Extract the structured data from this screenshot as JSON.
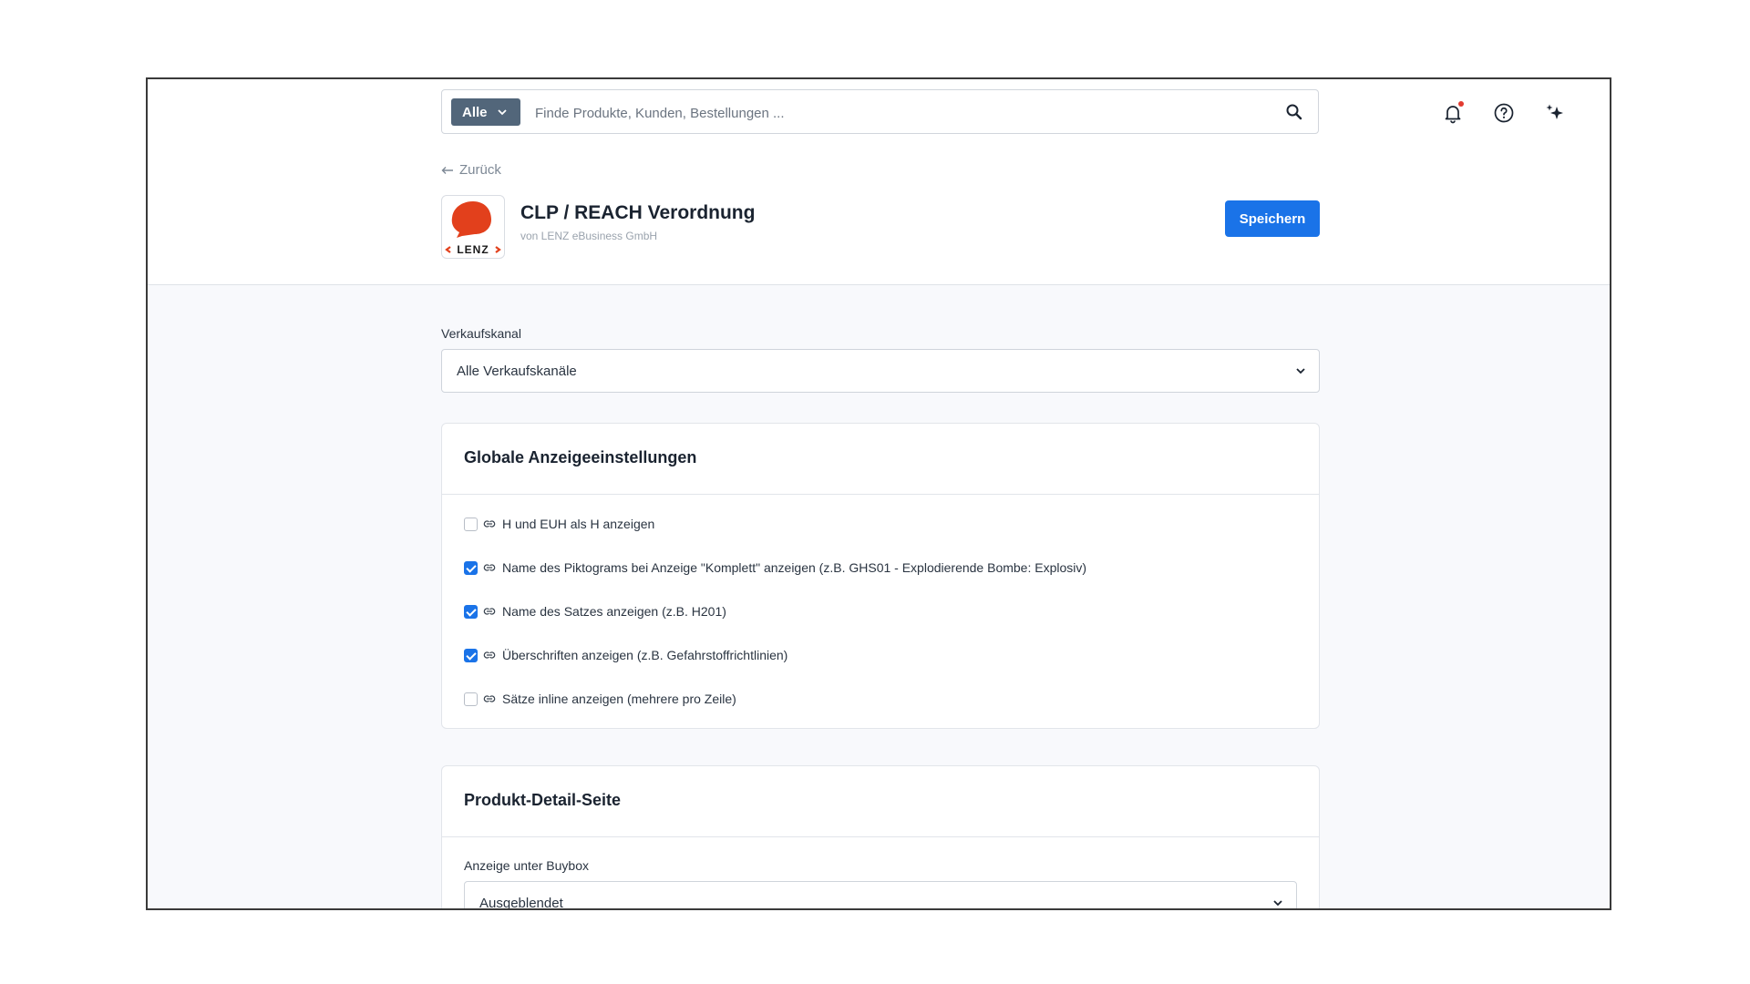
{
  "search": {
    "scope_label": "Alle",
    "placeholder": "Finde Produkte, Kunden, Bestellungen ..."
  },
  "header": {
    "back_label": "Zurück",
    "logo_text": "LENZ",
    "title": "CLP / REACH Verordnung",
    "vendor": "von LENZ eBusiness GmbH",
    "save_label": "Speichern"
  },
  "sales_channel": {
    "label": "Verkaufskanal",
    "value": "Alle Verkaufskanäle"
  },
  "global_settings": {
    "title": "Globale Anzeigeeinstellungen",
    "options": [
      {
        "label": "H und EUH als H anzeigen",
        "checked": false
      },
      {
        "label": "Name des Piktograms bei Anzeige \"Komplett\" anzeigen (z.B. GHS01 - Explodierende Bombe: Explosiv)",
        "checked": true
      },
      {
        "label": "Name des Satzes anzeigen (z.B. H201)",
        "checked": true
      },
      {
        "label": "Überschriften anzeigen (z.B. Gefahrstoffrichtlinien)",
        "checked": true
      },
      {
        "label": "Sätze inline anzeigen (mehrere pro Zeile)",
        "checked": false
      }
    ]
  },
  "product_detail": {
    "title": "Produkt-Detail-Seite",
    "buybox_label": "Anzeige unter Buybox",
    "buybox_value": "Ausgeblendet"
  },
  "colors": {
    "primary": "#1a73e8",
    "scope_bg": "#52667a",
    "logo_red": "#e2401c"
  }
}
